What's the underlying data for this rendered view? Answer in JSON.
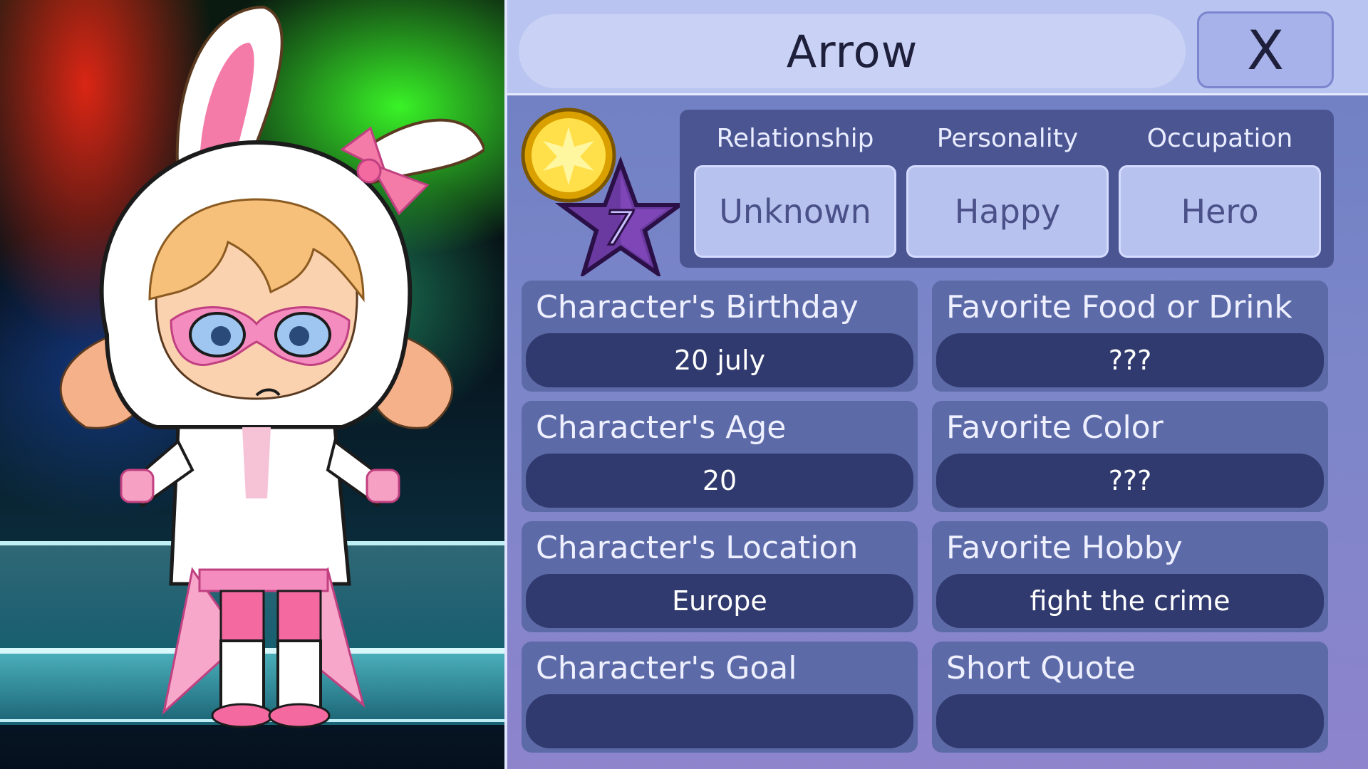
{
  "character": {
    "name": "Arrow",
    "level": "7"
  },
  "header": {
    "close_label": "X"
  },
  "traits": [
    {
      "label": "Relationship",
      "value": "Unknown"
    },
    {
      "label": "Personality",
      "value": "Happy"
    },
    {
      "label": "Occupation",
      "value": "Hero"
    }
  ],
  "fields": {
    "birthday": {
      "label": "Character's Birthday",
      "value": "20 july"
    },
    "food": {
      "label": "Favorite Food or Drink",
      "value": "???"
    },
    "age": {
      "label": "Character's Age",
      "value": "20"
    },
    "color": {
      "label": "Favorite Color",
      "value": "???"
    },
    "location": {
      "label": "Character's Location",
      "value": "Europe"
    },
    "hobby": {
      "label": "Favorite Hobby",
      "value": "fight the crime"
    },
    "goal": {
      "label": "Character's Goal",
      "value": ""
    },
    "quote": {
      "label": "Short Quote",
      "value": ""
    }
  },
  "colors": {
    "panel": "#7b86c9",
    "header": "#b9c4f0",
    "traits_box": "#4a5592",
    "field_card": "#5d6aa8",
    "field_value": "#303a6e",
    "title_text": "#1e1f3b"
  },
  "icons": {
    "close": "close-icon",
    "level_badge": "star-level-icon",
    "medal": "gold-medal-icon"
  }
}
